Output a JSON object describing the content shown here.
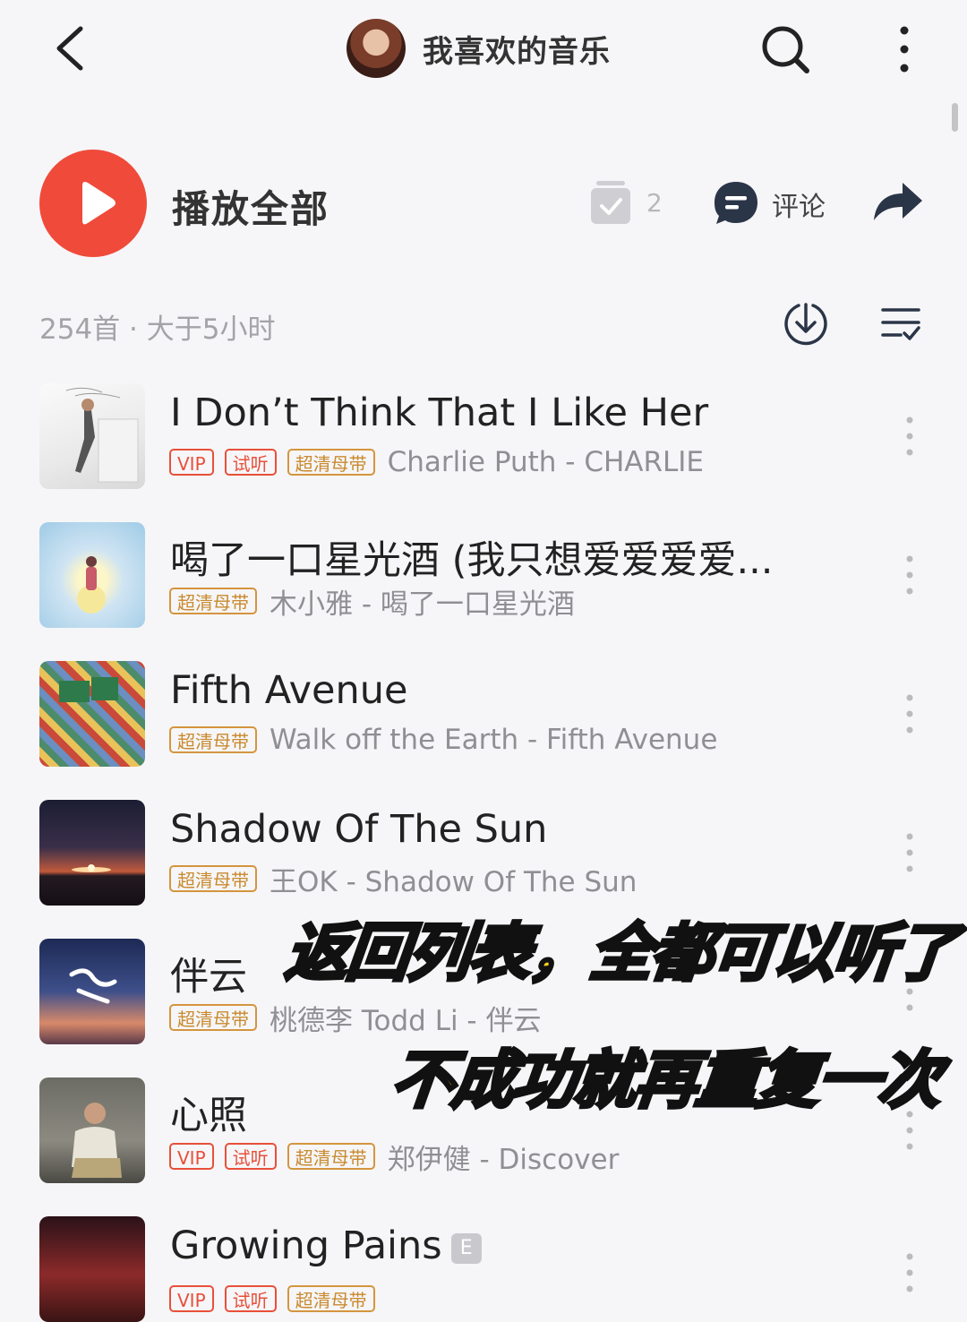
{
  "header": {
    "title": "我喜欢的音乐",
    "icons": [
      "back-icon",
      "avatar",
      "search-icon",
      "more-vertical-icon"
    ]
  },
  "actions": {
    "play_all": "播放全部",
    "collect_count": "2",
    "comment_label": "评论"
  },
  "summary": {
    "meta": "254首 · 大于5小时"
  },
  "tags": {
    "vip": "VIP",
    "trial": "试听",
    "sq": "超清母带"
  },
  "songs": [
    {
      "title": "I Don’t Think That I Like Her",
      "artist": "Charlie Puth - CHARLIE",
      "tags": [
        "vip",
        "trial",
        "sq"
      ]
    },
    {
      "title": "喝了一口星光酒 (我只想爱爱爱爱...",
      "artist": "木小雅 - 喝了一口星光酒",
      "tags": [
        "sq"
      ]
    },
    {
      "title": "Fifth Avenue",
      "artist": "Walk off the Earth - Fifth Avenue",
      "tags": [
        "sq"
      ]
    },
    {
      "title": "Shadow Of The Sun",
      "artist": "王OK - Shadow Of The Sun",
      "tags": [
        "sq"
      ]
    },
    {
      "title": "伴云",
      "artist": "桃德李 Todd Li - 伴云",
      "tags": [
        "sq"
      ]
    },
    {
      "title": "心照",
      "artist": "郑伊健 - Discover",
      "tags": [
        "vip",
        "trial",
        "sq"
      ]
    },
    {
      "title": "Growing Pains",
      "badge": "E",
      "artist": "",
      "tags": [
        "vip",
        "trial",
        "sq"
      ]
    }
  ],
  "captions": {
    "line1": "返回列表，全都可以听了",
    "line2": "不成功就再重复一次"
  },
  "colors": {
    "accent": "#f04a3a",
    "sq_tag": "#d4953e",
    "vip_tag": "#e8503a",
    "caption": "#ffd21e"
  }
}
